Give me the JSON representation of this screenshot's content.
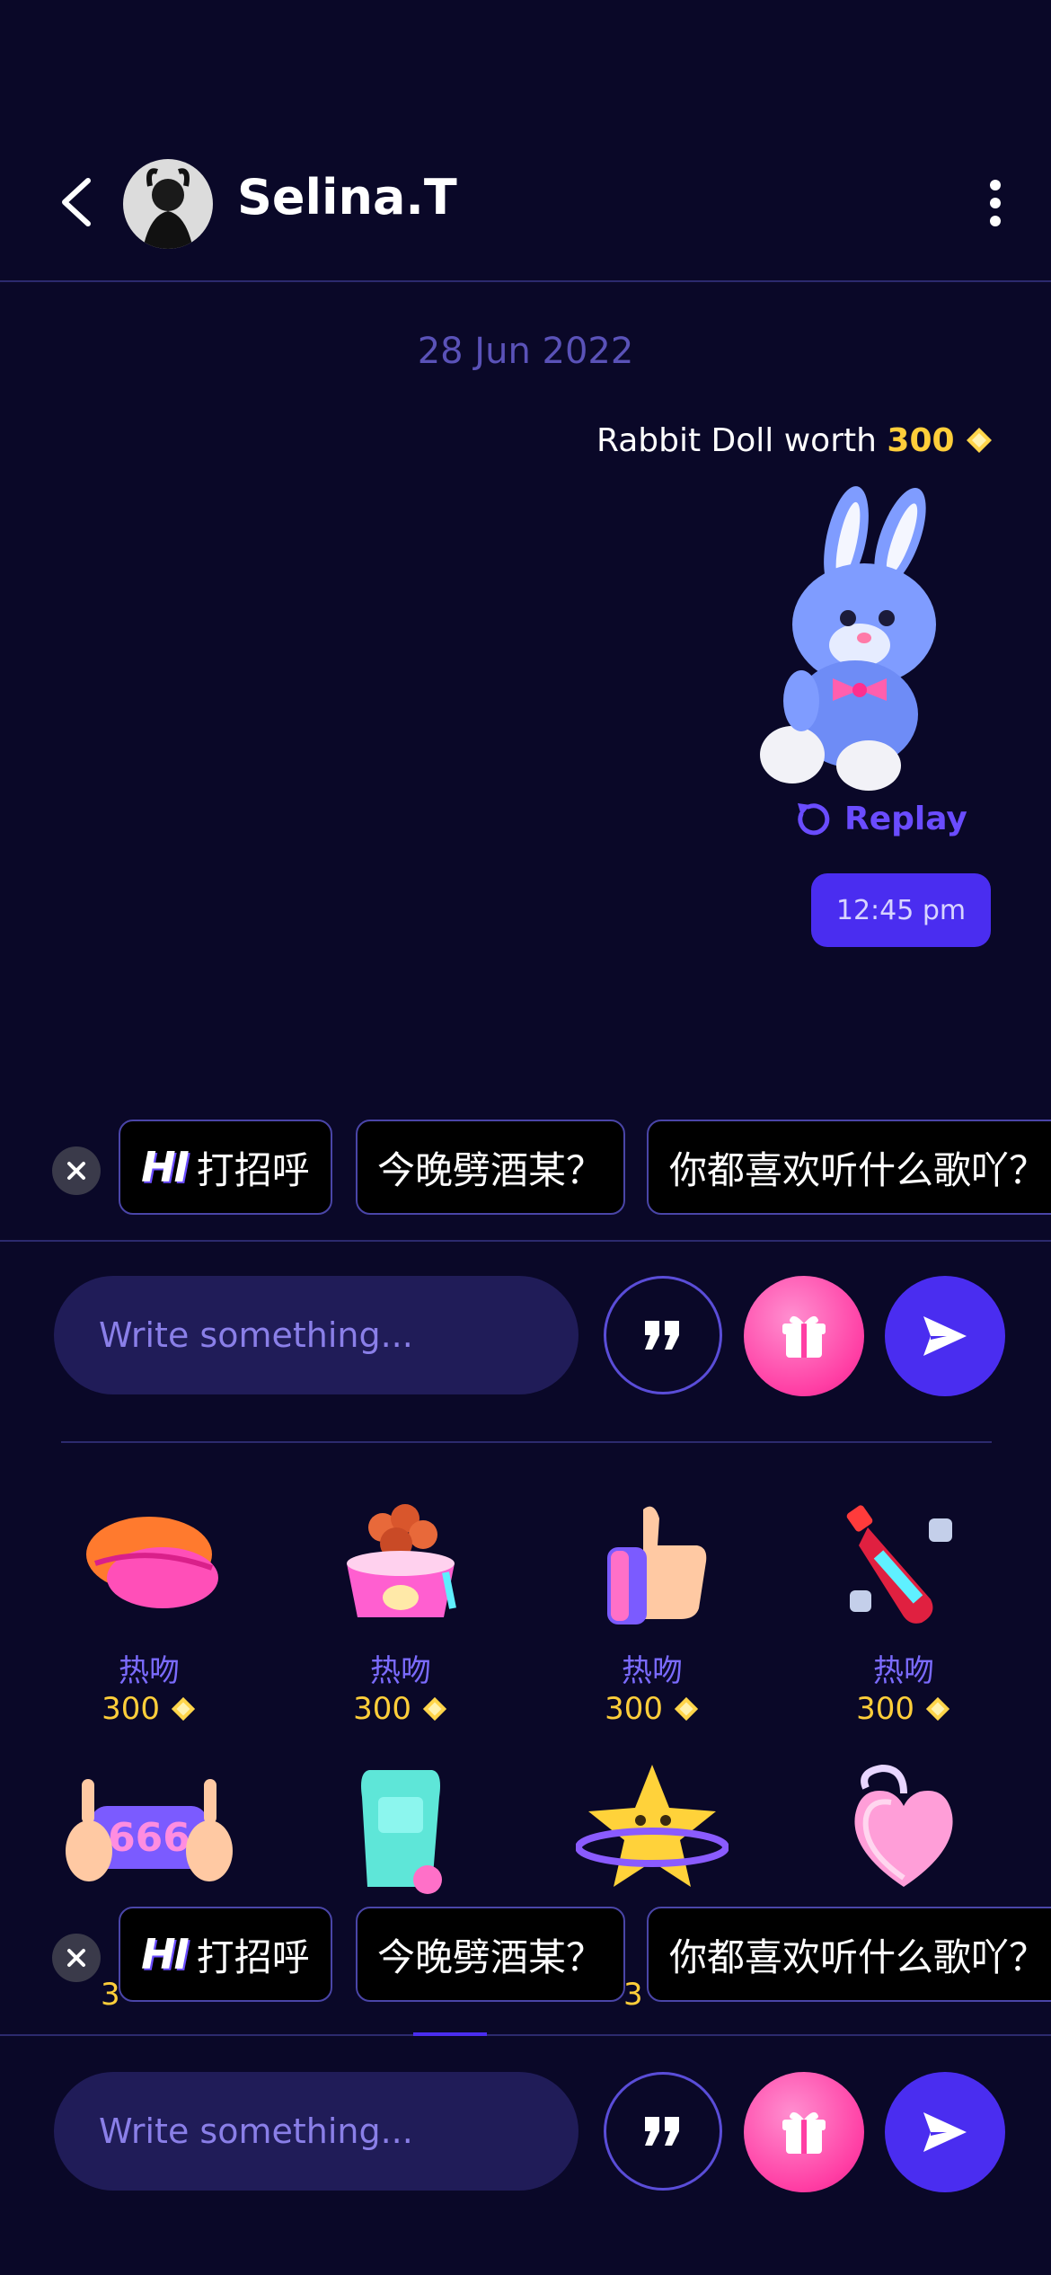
{
  "header": {
    "name": "Selina.T"
  },
  "chat": {
    "date": "28 Jun 2022",
    "gift_message_prefix": "Rabbit Doll worth",
    "gift_message_amount": "300",
    "replay_label": "Replay",
    "time": "12:45 pm"
  },
  "quick_phrases": {
    "hi_badge": "HI",
    "items": [
      "打招呼",
      "今晚劈酒某？",
      "你都喜欢听什么歌吖？"
    ]
  },
  "input": {
    "placeholder": "Write something..."
  },
  "gifts": [
    {
      "name": "热吻",
      "price": "300",
      "icon": "lips-icon"
    },
    {
      "name": "热吻",
      "price": "300",
      "icon": "pet-food-bowl-icon"
    },
    {
      "name": "热吻",
      "price": "300",
      "icon": "thumbs-up-icon"
    },
    {
      "name": "热吻",
      "price": "300",
      "icon": "soda-bottle-icon"
    },
    {
      "name": "",
      "price": "3",
      "icon": "hands-666-icon"
    },
    {
      "name": "",
      "price": "",
      "icon": "tube-icon"
    },
    {
      "name": "",
      "price": "3",
      "icon": "star-planet-icon"
    },
    {
      "name": "",
      "price": "",
      "icon": "heart-lock-icon"
    }
  ],
  "colors": {
    "background": "#0a0828",
    "accent": "#4a2df0",
    "gold": "#ffce3a",
    "gift_pink": "#ff3ea4"
  }
}
